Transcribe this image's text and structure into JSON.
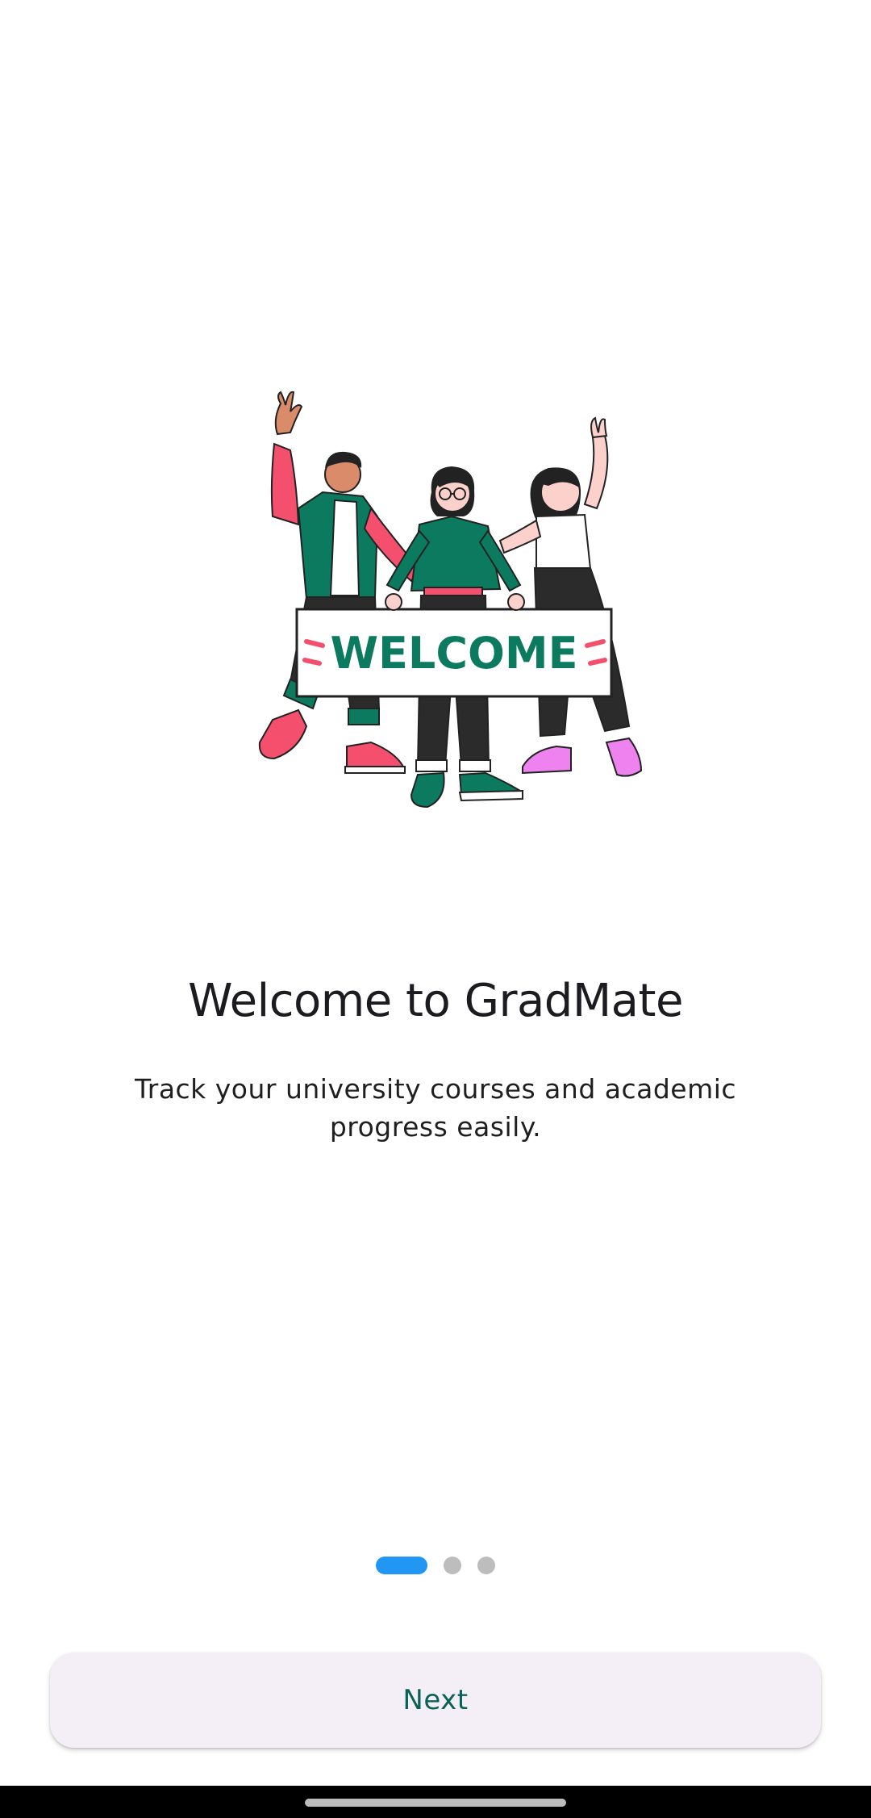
{
  "onboarding": {
    "illustration": {
      "icon": "welcome-people-illustration",
      "banner_text": "WELCOME"
    },
    "title": "Welcome to GradMate",
    "subtitle": "Track your university courses and academic progress easily.",
    "page_indicator": {
      "total_pages": 3,
      "current_page": 1
    },
    "next_label": "Next"
  },
  "colors": {
    "accent": "#2196F3",
    "inactive_dot": "#BDBDBD",
    "button_background": "#F4EFF7",
    "button_text": "#0B6156",
    "banner_green": "#0B7A5F",
    "pink": "#F4506E"
  }
}
